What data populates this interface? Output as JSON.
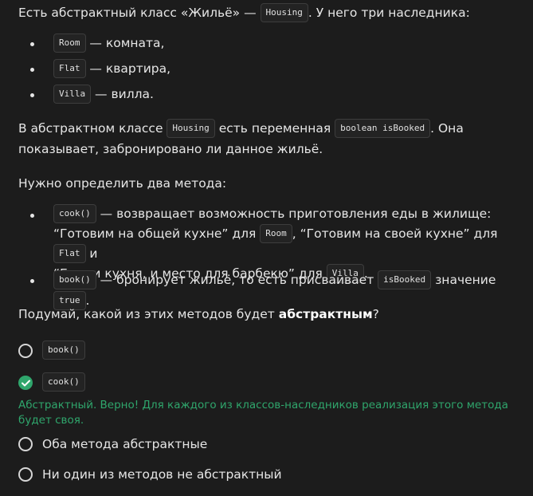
{
  "intro": {
    "prefix": "Есть абстрактный класс «Жильё» — ",
    "code": "Housing",
    "suffix": ". У него три наследника:"
  },
  "heirs": [
    {
      "code": "Room",
      "text": " — комната,"
    },
    {
      "code": "Flat",
      "text": " — квартира,"
    },
    {
      "code": "Villa",
      "text": " — вилла."
    }
  ],
  "para2": {
    "t1": "В абстрактном классе ",
    "c1": "Housing",
    "t2": " есть переменная ",
    "c2": "boolean isBooked",
    "t3": ". Она",
    "line2": "показывает, забронировано ли данное жильё."
  },
  "para3": "Нужно определить два метода:",
  "methods": {
    "cook": {
      "code": "cook()",
      "t1": " — возвращает возможность приготовления еды в жилище:",
      "t2": "“Готовим на общей кухне” для ",
      "c_room": "Room",
      "t3": ", “Готовим на своей кухне” для ",
      "c_flat": "Flat",
      "t4": " и",
      "t5": "“Есть и кухня, и место для барбекю” для ",
      "c_villa": "Villa",
      "t6": "."
    },
    "book": {
      "code": "book()",
      "t1": " — бронирует жильё, то есть присваивает ",
      "c_isbooked": "isBooked",
      "t2": " значение ",
      "c_true": "true",
      "t3": "."
    }
  },
  "question": {
    "prefix": "Подумай, какой из этих методов будет ",
    "bold": "абстрактным",
    "suffix": "?"
  },
  "options": [
    {
      "code": "book()",
      "checked": false
    },
    {
      "code": "cook()",
      "checked": true
    },
    {
      "text": "Оба метода абстрактные",
      "checked": false
    },
    {
      "text": "Ни один из методов не абстрактный",
      "checked": false
    }
  ],
  "feedback": "Абстрактный. Верно! Для каждого из классов-наследников реализация этого метода будет своя.",
  "colors": {
    "background": "#1c1c1c",
    "text": "#e6e6e6",
    "accent_green": "#2fa66c"
  },
  "icons": {
    "checked_option": "check-icon"
  }
}
